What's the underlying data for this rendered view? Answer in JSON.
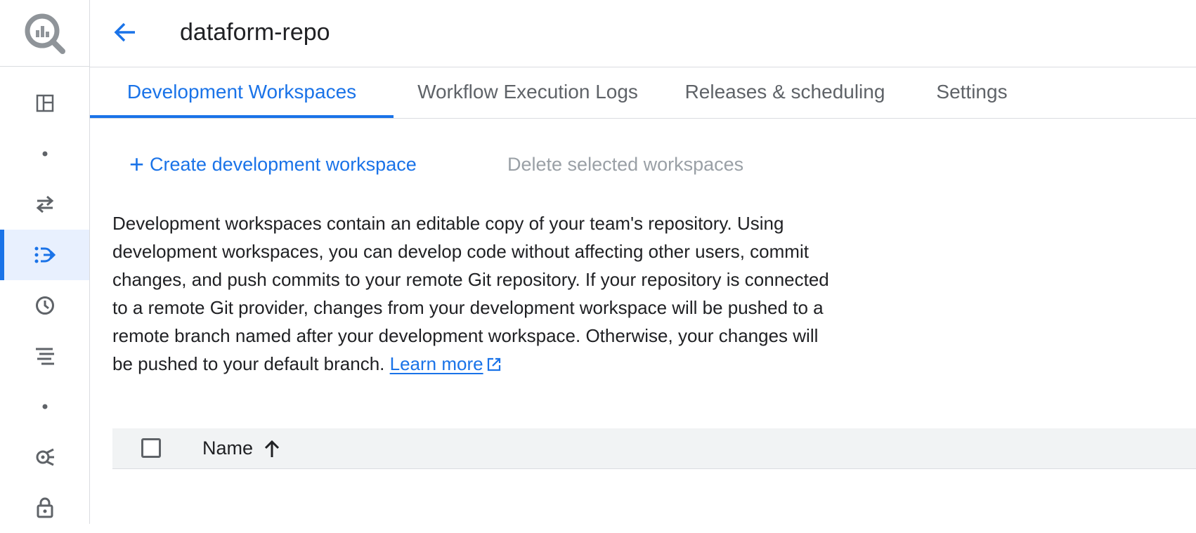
{
  "colors": {
    "accent": "#1a73e8",
    "text": "#202124",
    "muted": "#5f6368",
    "disabled": "#9aa0a6"
  },
  "rail": {
    "logo_icon": "bigquery-logo-icon",
    "items": [
      {
        "icon": "overview-panel-icon"
      },
      {
        "icon": "dot-icon"
      },
      {
        "icon": "data-transfer-icon"
      },
      {
        "icon": "dataform-icon",
        "active": true
      },
      {
        "icon": "scheduled-queries-icon"
      },
      {
        "icon": "analytics-hub-icon"
      },
      {
        "icon": "dot-icon"
      },
      {
        "icon": "data-lineage-icon"
      },
      {
        "icon": "lock-icon"
      }
    ]
  },
  "header": {
    "title": "dataform-repo",
    "back_icon": "arrow-back-icon"
  },
  "tabs": [
    {
      "label": "Development Workspaces",
      "active": true
    },
    {
      "label": "Workflow Execution Logs"
    },
    {
      "label": "Releases & scheduling"
    },
    {
      "label": "Settings"
    }
  ],
  "toolbar": {
    "create_label": "Create development workspace",
    "delete_label": "Delete selected workspaces"
  },
  "description": {
    "text": "Development workspaces contain an editable copy of your team's repository. Using development workspaces, you can develop code without affecting other users, commit changes, and push commits to your remote Git repository. If your repository is connected to a remote Git provider, changes from your development workspace will be pushed to a remote branch named after your development workspace. Otherwise, your changes will be pushed to your default branch.",
    "link_label": "Learn more"
  },
  "table": {
    "columns": [
      {
        "label": "Name",
        "sort": "ascending"
      }
    ]
  }
}
